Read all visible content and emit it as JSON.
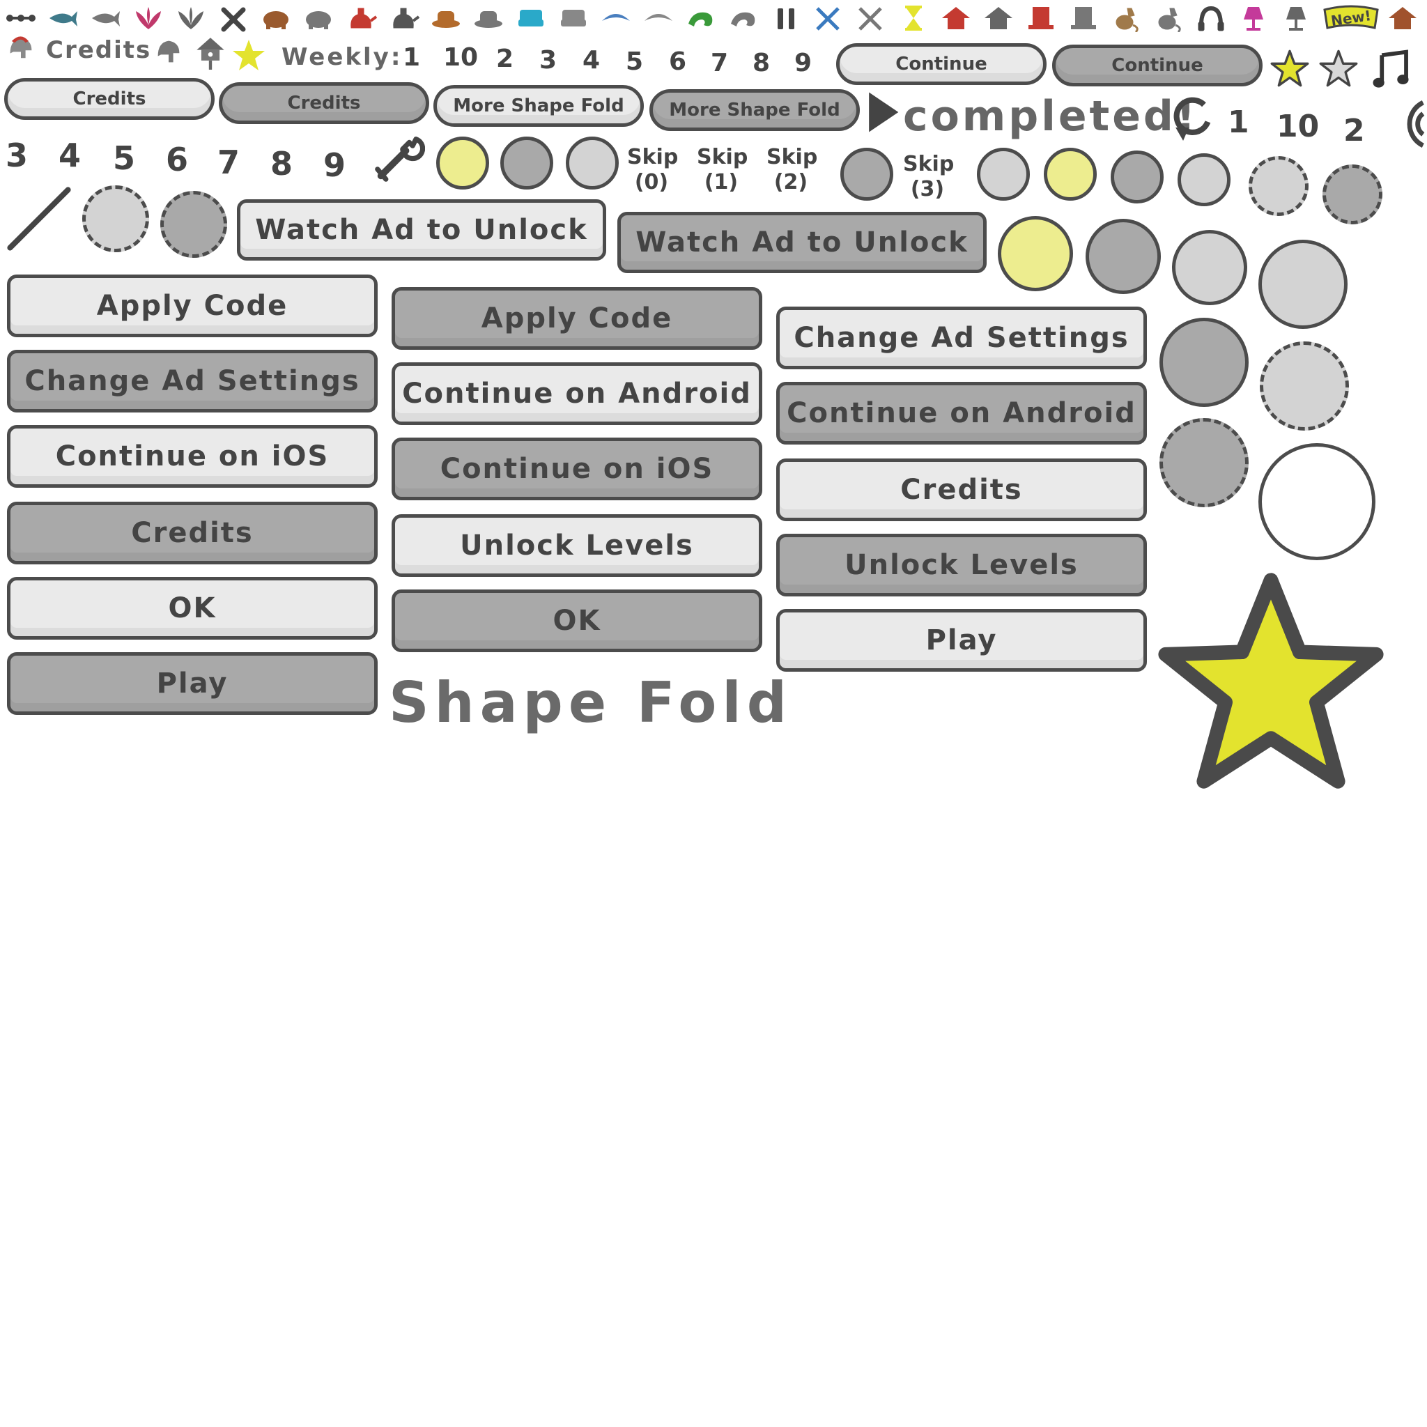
{
  "top_icons": [
    {
      "name": "molecule-icon",
      "color": "#444444"
    },
    {
      "name": "shark-icon",
      "color": "#3f7a8a"
    },
    {
      "name": "shark-gray-icon",
      "color": "#777777"
    },
    {
      "name": "lotus-icon",
      "color": "#c0396b"
    },
    {
      "name": "lotus-gray-icon",
      "color": "#666666"
    },
    {
      "name": "close-icon",
      "color": "#444444"
    },
    {
      "name": "bear-icon",
      "color": "#9a5a2e"
    },
    {
      "name": "bear-gray-icon",
      "color": "#777777"
    },
    {
      "name": "kettle-icon",
      "color": "#c43a31"
    },
    {
      "name": "kettle-gray-icon",
      "color": "#555555"
    },
    {
      "name": "hat-icon",
      "color": "#b36b2c"
    },
    {
      "name": "hat-gray-icon",
      "color": "#777777"
    },
    {
      "name": "armchair-icon",
      "color": "#2aa9c9"
    },
    {
      "name": "armchair-gray-icon",
      "color": "#888888"
    },
    {
      "name": "bird-icon",
      "color": "#4a7fbf"
    },
    {
      "name": "bird-gray-icon",
      "color": "#888888"
    },
    {
      "name": "chameleon-icon",
      "color": "#3a9a3a"
    },
    {
      "name": "chameleon-gray-icon",
      "color": "#777777"
    },
    {
      "name": "pause-icon",
      "color": "#444444"
    },
    {
      "name": "crossed-swords-icon",
      "color": "#3a7abf"
    },
    {
      "name": "crossed-swords-gray-icon",
      "color": "#777777"
    },
    {
      "name": "hourglass-icon",
      "color": "#e3e32e"
    },
    {
      "name": "birdhouse-icon",
      "color": "#c43a31"
    },
    {
      "name": "birdhouse-gray-icon",
      "color": "#666666"
    },
    {
      "name": "top-hat-icon",
      "color": "#c43a31"
    },
    {
      "name": "top-hat-gray-icon",
      "color": "#777777"
    },
    {
      "name": "cat-icon",
      "color": "#a07a4a"
    },
    {
      "name": "cat-gray-icon",
      "color": "#777777"
    },
    {
      "name": "headphones-icon",
      "color": "#444444"
    },
    {
      "name": "lamp-icon",
      "color": "#c43a9a"
    },
    {
      "name": "lamp-gray-icon",
      "color": "#666666"
    },
    {
      "name": "new-badge",
      "label": "New!",
      "color": "#e3e32e"
    },
    {
      "name": "birdhouse-small-icon",
      "color": "#a0522d"
    }
  ],
  "row2": {
    "credits_label": "Credits",
    "weekly_label": "Weekly:",
    "numbers": [
      "1",
      "10",
      "2",
      "3",
      "4",
      "5",
      "6",
      "7",
      "8",
      "9"
    ],
    "continue_light": "Continue",
    "continue_dark": "Continue"
  },
  "row3": {
    "credits_light": "Credits",
    "credits_dark": "Credits",
    "more_light": "More Shape Fold",
    "more_dark": "More Shape Fold",
    "completed": "completed!",
    "numbers": [
      "1",
      "10",
      "2"
    ]
  },
  "row4": {
    "numbers": [
      "3",
      "4",
      "5",
      "6",
      "7",
      "8",
      "9"
    ],
    "skips": [
      {
        "label": "Skip",
        "count": "(0)"
      },
      {
        "label": "Skip",
        "count": "(1)"
      },
      {
        "label": "Skip",
        "count": "(2)"
      },
      {
        "label": "Skip",
        "count": "(3)"
      }
    ]
  },
  "watch_ad": {
    "light": "Watch Ad to Unlock",
    "dark": "Watch Ad to Unlock"
  },
  "buttons": {
    "col1": [
      "Apply Code",
      "Change Ad Settings",
      "Continue on iOS",
      "Credits",
      "OK",
      "Play"
    ],
    "col2": [
      "Apply Code",
      "Continue on Android",
      "Continue on iOS",
      "Unlock Levels",
      "OK"
    ],
    "col3": [
      "Change Ad Settings",
      "Continue on Android",
      "Credits",
      "Unlock Levels",
      "Play"
    ]
  },
  "logo": "Shape Fold",
  "colors": {
    "outline": "#4c4c4c",
    "light_button": "#eaeaea",
    "dark_button": "#a9a9a9",
    "yellow": "#e3e32e",
    "pale_yellow": "#eded8f"
  }
}
